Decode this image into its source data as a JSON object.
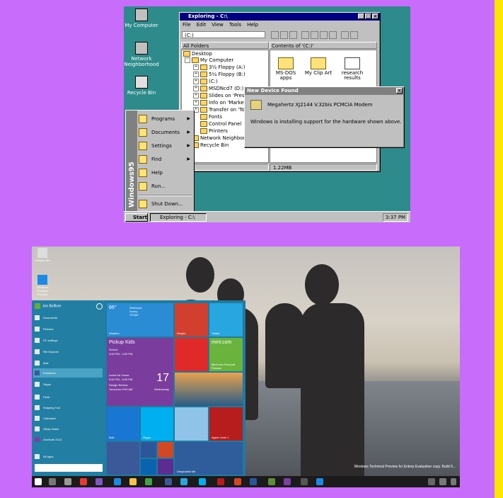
{
  "win95": {
    "desktop_icons": [
      "My Computer",
      "Network Neighborhood",
      "Recycle Bin"
    ],
    "explorer": {
      "title": "Exploring - C:\\",
      "menu": [
        "File",
        "Edit",
        "View",
        "Tools",
        "Help"
      ],
      "address": "(C:)",
      "left_header": "All Folders",
      "right_header": "Contents of '(C:)'",
      "tree": [
        "Desktop",
        "My Computer",
        "3½ Floppy (A:)",
        "5¼ Floppy (B:)",
        "(C:)",
        "MSDNcd7 (D:)",
        "Slides on 'Preser",
        "Info on 'Marketir",
        "Transfer on 'Tod",
        "Fonts",
        "Control Panel",
        "Printers",
        "Network Neighborhood",
        "Recycle Bin"
      ],
      "contents": [
        "MS-DOS apps",
        "My Clip Art",
        "research results"
      ],
      "status": "1.22MB"
    },
    "dialog": {
      "title": "New Device Found",
      "device": "Megahertz XJ2144 V.32bis PCMCIA Modem",
      "message": "Windows is installing support for the hardware shown above."
    },
    "start_menu": {
      "brand": "Windows95",
      "items": [
        "Programs",
        "Documents",
        "Settings",
        "Find",
        "Help",
        "Run...",
        "Shut Down..."
      ]
    },
    "taskbar": {
      "start": "Start",
      "task": "Exploring - C:\\",
      "clock": "3:37 PM"
    }
  },
  "win10": {
    "desktop_icons": [
      "Recycle Bin",
      "Windows Technical Preview"
    ],
    "user": "Joe Belfiore",
    "left_items": [
      "Documents",
      "Pictures",
      "PC settings",
      "File Explorer",
      "Mail",
      "Facebook",
      "Skype",
      "Paint",
      "Snipping Tool",
      "Calculator",
      "Sticky Notes",
      "OneNote 2013"
    ],
    "all_apps": "All Apps",
    "weather": {
      "temp": "66°",
      "place": "Redmond",
      "cond": "Sunny",
      "range": "76°/58°",
      "label": "Weather"
    },
    "calendar": {
      "title": "Pickup Kids",
      "sub": "School",
      "time": "3:00 PM - 4:00 PM",
      "line1": "Leave for Home",
      "line1_time": "5:00 PM - 6:00 PM",
      "line2": "Design Review",
      "line2_time": "Tomorrow 9:00 AM",
      "day": "17",
      "weekday": "Wednesday"
    },
    "tiles": {
      "people": "People",
      "twitter": "Twitter",
      "mint": "mint.com",
      "mint_sub": "Mint.com Personal Finance",
      "mail": "Mail",
      "skype": "Skype",
      "agent": "Agent Level 1",
      "despicable": "Despicable Me"
    },
    "watermark": "Windows Technical Preview for Enterp Evaluation copy. Build 9..."
  }
}
